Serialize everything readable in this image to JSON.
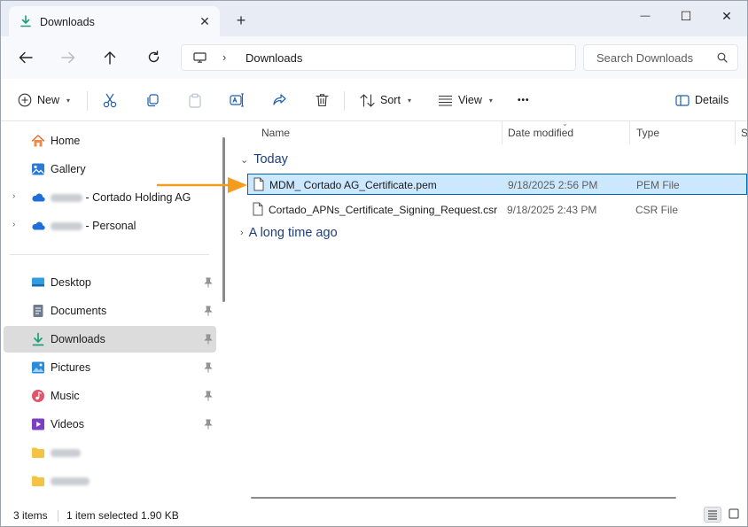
{
  "titlebar": {
    "tab_title": "Downloads",
    "tab_close": "✕",
    "new_tab": "+",
    "minimize": "—",
    "maximize": "☐",
    "close": "✕"
  },
  "addressbar": {
    "path_segment": "Downloads",
    "search_placeholder": "Search Downloads"
  },
  "commandbar": {
    "new_label": "New",
    "sort_label": "Sort",
    "view_label": "View",
    "more_label": "•••",
    "details_label": "Details"
  },
  "navpane": {
    "items": [
      {
        "label": "Home",
        "icon": "home-icon"
      },
      {
        "label": "Gallery",
        "icon": "gallery-icon"
      },
      {
        "label": "- Cortado Holding AG",
        "icon": "onedrive-icon",
        "expandable": true
      },
      {
        "label": "- Personal",
        "icon": "onedrive-icon",
        "expandable": true
      },
      {
        "label": "Desktop",
        "icon": "desktop-icon",
        "pinned": true
      },
      {
        "label": "Documents",
        "icon": "documents-icon",
        "pinned": true
      },
      {
        "label": "Downloads",
        "icon": "downloads-icon",
        "pinned": true,
        "selected": true
      },
      {
        "label": "Pictures",
        "icon": "pictures-icon",
        "pinned": true
      },
      {
        "label": "Music",
        "icon": "music-icon",
        "pinned": true
      },
      {
        "label": "Videos",
        "icon": "videos-icon",
        "pinned": true
      }
    ]
  },
  "filepane": {
    "columns": {
      "name": "Name",
      "date": "Date modified",
      "type": "Type",
      "size": "S"
    },
    "groups": [
      {
        "label": "Today",
        "expanded": true
      },
      {
        "label": "A long time ago",
        "expanded": false
      }
    ],
    "files": [
      {
        "name": "MDM_ Cortado AG_Certificate.pem",
        "date": "9/18/2025 2:56 PM",
        "type": "PEM File",
        "selected": true
      },
      {
        "name": "Cortado_APNs_Certificate_Signing_Request.csr",
        "date": "9/18/2025 2:43 PM",
        "type": "CSR File",
        "selected": false
      }
    ]
  },
  "statusbar": {
    "item_count": "3 items",
    "selection": "1 item selected  1.90 KB"
  },
  "colors": {
    "accent": "#0067c0",
    "selection_bg": "#cce8ff",
    "selection_border": "#0066b4",
    "group_header": "#1f3e7a",
    "annotation_arrow": "#f39c1e"
  }
}
